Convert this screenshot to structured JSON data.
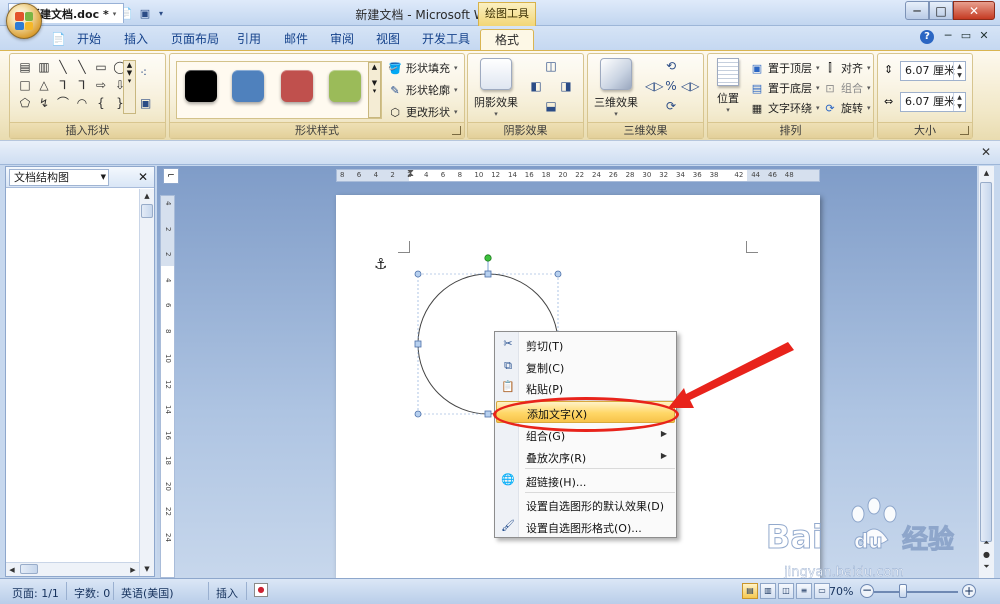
{
  "window": {
    "title": "新建文档 - Microsoft Word",
    "context_tab_title": "绘图工具",
    "min": "─",
    "max": "□",
    "close": "✕"
  },
  "tabs": [
    {
      "label": "开始"
    },
    {
      "label": "插入"
    },
    {
      "label": "页面布局"
    },
    {
      "label": "引用"
    },
    {
      "label": "邮件"
    },
    {
      "label": "审阅"
    },
    {
      "label": "视图"
    },
    {
      "label": "开发工具"
    },
    {
      "label": "格式"
    }
  ],
  "ribbon": {
    "insert_shapes": {
      "label": "插入形状"
    },
    "shape_styles": {
      "label": "形状样式",
      "swatches": [
        "#000000",
        "#4f81bd",
        "#c0504d",
        "#9bbb59"
      ],
      "fill": "形状填充",
      "outline": "形状轮廓",
      "change_shape": "更改形状"
    },
    "shadow_effects": {
      "label": "阴影效果",
      "button": "阴影效果"
    },
    "threed_effects": {
      "label": "三维效果",
      "button": "三维效果"
    },
    "arrange": {
      "label": "排列",
      "position": "位置",
      "bring_front": "置于顶层",
      "send_back": "置于底层",
      "text_wrap": "文字环绕",
      "align": "对齐",
      "group": "组合",
      "rotate": "旋转"
    },
    "size": {
      "label": "大小",
      "height": "6.07 厘米",
      "width": "6.07 厘米"
    }
  },
  "document": {
    "tab_label": "新建文档.doc *"
  },
  "nav_pane": {
    "title": "文档结构图"
  },
  "ruler": {
    "h": [
      "8",
      "6",
      "4",
      "2",
      "2",
      "4",
      "6",
      "8",
      "10",
      "12",
      "14",
      "16",
      "18",
      "20",
      "22",
      "24",
      "26",
      "28",
      "30",
      "32",
      "34",
      "36",
      "38",
      "42",
      "44",
      "46",
      "48"
    ],
    "v": [
      "4",
      "2",
      "2",
      "4",
      "6",
      "8",
      "10",
      "12",
      "14",
      "16",
      "18",
      "20",
      "22",
      "24"
    ]
  },
  "context_menu": {
    "items": [
      {
        "label": "剪切(T)",
        "icon": "scissors-icon"
      },
      {
        "label": "复制(C)",
        "icon": "copy-icon"
      },
      {
        "label": "粘贴(P)",
        "icon": "paste-icon"
      },
      {
        "label": "添加文字(X)",
        "icon": ""
      },
      {
        "label": "组合(G)",
        "icon": ""
      },
      {
        "label": "叠放次序(R)",
        "icon": ""
      },
      {
        "label": "超链接(H)...",
        "icon": "globe-icon"
      },
      {
        "label": "设置自选图形的默认效果(D)",
        "icon": ""
      },
      {
        "label": "设置自选图形格式(O)...",
        "icon": "format-icon"
      }
    ]
  },
  "statusbar": {
    "page": "页面: 1/1",
    "words": "字数: 0",
    "lang": "英语(美国)",
    "insert": "插入",
    "zoom": "70%",
    "zoom_fraction": 0.35
  },
  "watermark": {
    "brand": "Bai",
    "brand2": "du",
    "cn": "经验",
    "url": "jingyan.baidu.com"
  },
  "colors": {
    "accent": "#e8231b",
    "ribbon_border": "#d9b552",
    "highlight": "#ffd767"
  }
}
